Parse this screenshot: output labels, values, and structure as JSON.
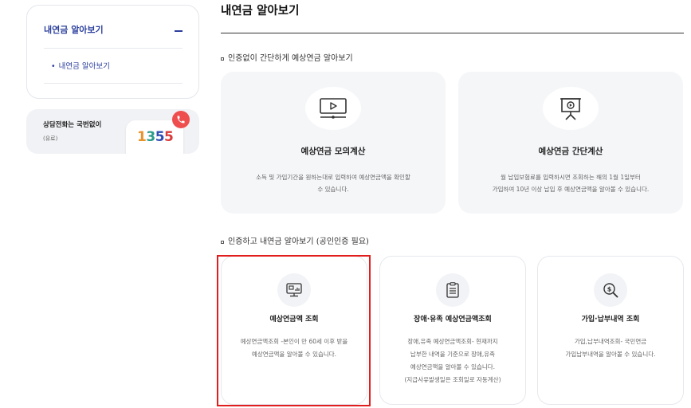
{
  "sidebar": {
    "menu_title": "내연금 알아보기",
    "sub_items": [
      "내연금 알아보기"
    ],
    "phone": {
      "title": "상담전화는 국번없이",
      "note": "(유료)",
      "number_digits": [
        "1",
        "3",
        "5",
        "5"
      ]
    }
  },
  "main": {
    "title": "내연금 알아보기",
    "section1": {
      "heading": "인증없이 간단하게 예상연금 알아보기",
      "cards": [
        {
          "icon": "video-screen-icon",
          "title": "예상연금 모의계산",
          "desc_lines": [
            "소득 및 가입기간을 원하는대로 입력하여 예상연금액을 확인할",
            "수 있습니다."
          ]
        },
        {
          "icon": "presentation-board-icon",
          "title": "예상연금 간단계산",
          "desc_lines": [
            "월 납입보험료를 입력하시면 조회하는 해의 1월 1일부터",
            "가입하여 10년 이상 납입 후 예상연금액을 알아볼 수 있습니다."
          ]
        }
      ]
    },
    "section2": {
      "heading": "인증하고 내연금 알아보기 (공인인증 필요)",
      "cards": [
        {
          "icon": "monitor-chart-icon",
          "title": "예상연금액 조회",
          "desc_lines": [
            "예상연금액조회 -본인이 만 60세 이후 받을",
            "예상연금액을 알아볼 수 있습니다."
          ]
        },
        {
          "icon": "clipboard-list-icon",
          "title": "장애·유족 예상연금액조회",
          "desc_lines": [
            "장애,유족 예상연금액조회- 현재까지",
            "납부한 내역을 기준으로 장애,유족",
            "예상연금액을 알아볼 수 있습니다.",
            "(지급사유발생일은 조회일로 자동계산)"
          ]
        },
        {
          "icon": "coin-magnifier-icon",
          "title": "가입·납부내역 조회",
          "desc_lines": [
            "가입,납부내역조회- 국민연금",
            "가입납부내역을 알아볼 수 있습니다."
          ]
        }
      ]
    }
  },
  "colors": {
    "accent_blue": "#2b3f9d",
    "highlight_red": "#e01e1e",
    "badge_red": "#ef4e4e",
    "card_bg": "#f5f6f8"
  }
}
